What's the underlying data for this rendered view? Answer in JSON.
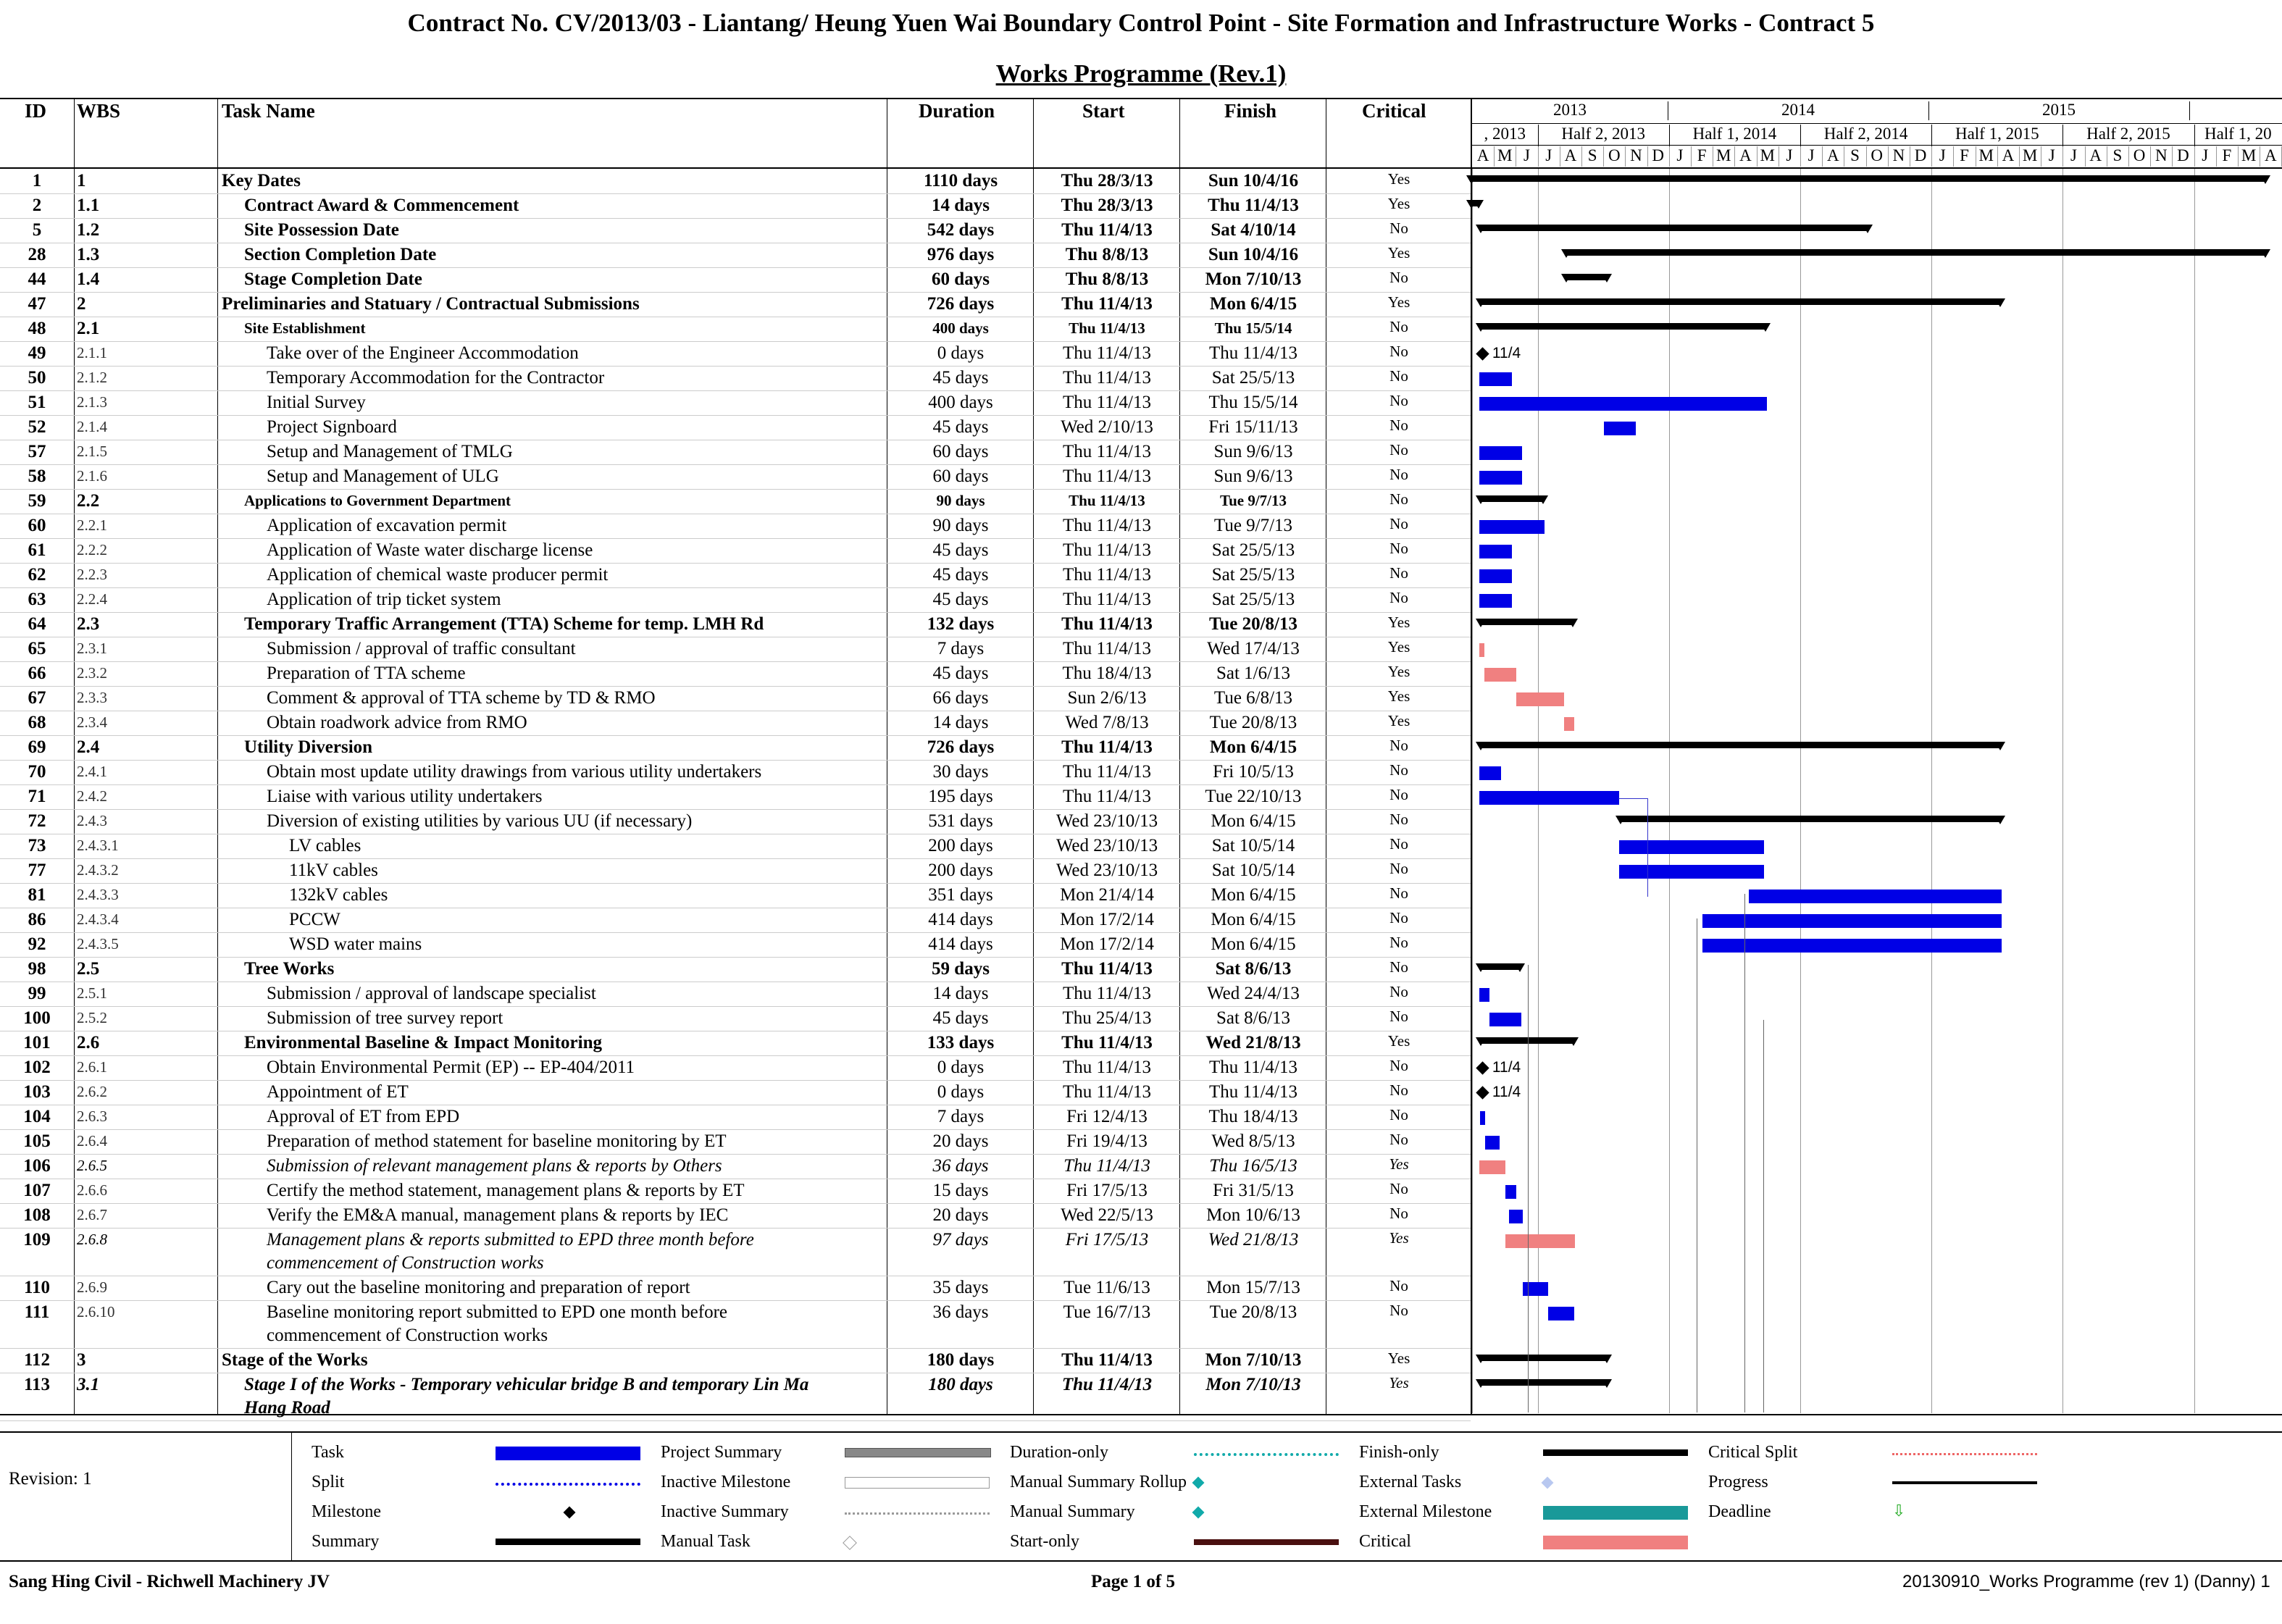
{
  "header": {
    "title": "Contract No. CV/2013/03 - Liantang/ Heung Yuen Wai Boundary Control Point - Site Formation and Infrastructure Works - Contract 5",
    "subtitle": "Works Programme (Rev.1)"
  },
  "columns": {
    "id": "ID",
    "wbs": "WBS",
    "task": "Task Name",
    "duration": "Duration",
    "start": "Start",
    "finish": "Finish",
    "critical": "Critical"
  },
  "timescale": {
    "years": [
      "2013",
      "2014",
      "2015"
    ],
    "halves": [
      ", 2013",
      "Half 2, 2013",
      "Half 1, 2014",
      "Half 2, 2014",
      "Half 1, 2015",
      "Half 2, 2015",
      "Half 1, 20"
    ],
    "months": [
      "A",
      "M",
      "J",
      "J",
      "A",
      "S",
      "O",
      "N",
      "D",
      "J",
      "F",
      "M",
      "A",
      "M",
      "J",
      "J",
      "A",
      "S",
      "O",
      "N",
      "D",
      "J",
      "F",
      "M",
      "A",
      "M",
      "J",
      "J",
      "A",
      "S",
      "O",
      "N",
      "D",
      "J",
      "F",
      "M",
      "A"
    ]
  },
  "tasks": [
    {
      "id": "1",
      "wbs": "1",
      "name": "Key Dates",
      "duration": "1110 days",
      "start": "Thu 28/3/13",
      "finish": "Sun 10/4/16",
      "critical": "Yes",
      "level": 0,
      "style": "b"
    },
    {
      "id": "2",
      "wbs": "1.1",
      "name": "Contract Award & Commencement",
      "duration": "14 days",
      "start": "Thu 28/3/13",
      "finish": "Thu 11/4/13",
      "critical": "Yes",
      "level": 1,
      "style": "b"
    },
    {
      "id": "5",
      "wbs": "1.2",
      "name": "Site Possession Date",
      "duration": "542 days",
      "start": "Thu 11/4/13",
      "finish": "Sat 4/10/14",
      "critical": "No",
      "level": 1,
      "style": "b"
    },
    {
      "id": "28",
      "wbs": "1.3",
      "name": "Section Completion Date",
      "duration": "976 days",
      "start": "Thu 8/8/13",
      "finish": "Sun 10/4/16",
      "critical": "Yes",
      "level": 1,
      "style": "b"
    },
    {
      "id": "44",
      "wbs": "1.4",
      "name": "Stage Completion Date",
      "duration": "60 days",
      "start": "Thu 8/8/13",
      "finish": "Mon 7/10/13",
      "critical": "No",
      "level": 1,
      "style": "b"
    },
    {
      "id": "47",
      "wbs": "2",
      "name": "Preliminaries and Statuary / Contractual Submissions",
      "duration": "726 days",
      "start": "Thu 11/4/13",
      "finish": "Mon 6/4/15",
      "critical": "Yes",
      "level": 0,
      "style": "b"
    },
    {
      "id": "48",
      "wbs": "2.1",
      "name": "Site Establishment",
      "duration": "400 days",
      "start": "Thu 11/4/13",
      "finish": "Thu 15/5/14",
      "critical": "No",
      "level": 1,
      "style": "bs"
    },
    {
      "id": "49",
      "wbs": "2.1.1",
      "name": "Take over of the Engineer Accommodation",
      "duration": "0 days",
      "start": "Thu 11/4/13",
      "finish": "Thu 11/4/13",
      "critical": "No",
      "level": 2,
      "style": ""
    },
    {
      "id": "50",
      "wbs": "2.1.2",
      "name": "Temporary Accommodation for the Contractor",
      "duration": "45 days",
      "start": "Thu 11/4/13",
      "finish": "Sat 25/5/13",
      "critical": "No",
      "level": 2,
      "style": ""
    },
    {
      "id": "51",
      "wbs": "2.1.3",
      "name": "Initial Survey",
      "duration": "400 days",
      "start": "Thu 11/4/13",
      "finish": "Thu 15/5/14",
      "critical": "No",
      "level": 2,
      "style": ""
    },
    {
      "id": "52",
      "wbs": "2.1.4",
      "name": "Project Signboard",
      "duration": "45 days",
      "start": "Wed 2/10/13",
      "finish": "Fri 15/11/13",
      "critical": "No",
      "level": 2,
      "style": ""
    },
    {
      "id": "57",
      "wbs": "2.1.5",
      "name": "Setup and Management of TMLG",
      "duration": "60 days",
      "start": "Thu 11/4/13",
      "finish": "Sun 9/6/13",
      "critical": "No",
      "level": 2,
      "style": ""
    },
    {
      "id": "58",
      "wbs": "2.1.6",
      "name": "Setup and Management of ULG",
      "duration": "60 days",
      "start": "Thu 11/4/13",
      "finish": "Sun 9/6/13",
      "critical": "No",
      "level": 2,
      "style": ""
    },
    {
      "id": "59",
      "wbs": "2.2",
      "name": "Applications to Government Department",
      "duration": "90 days",
      "start": "Thu 11/4/13",
      "finish": "Tue 9/7/13",
      "critical": "No",
      "level": 1,
      "style": "bs"
    },
    {
      "id": "60",
      "wbs": "2.2.1",
      "name": "Application of excavation permit",
      "duration": "90 days",
      "start": "Thu 11/4/13",
      "finish": "Tue 9/7/13",
      "critical": "No",
      "level": 2,
      "style": ""
    },
    {
      "id": "61",
      "wbs": "2.2.2",
      "name": "Application of Waste water discharge license",
      "duration": "45 days",
      "start": "Thu 11/4/13",
      "finish": "Sat 25/5/13",
      "critical": "No",
      "level": 2,
      "style": ""
    },
    {
      "id": "62",
      "wbs": "2.2.3",
      "name": "Application of chemical waste producer permit",
      "duration": "45 days",
      "start": "Thu 11/4/13",
      "finish": "Sat 25/5/13",
      "critical": "No",
      "level": 2,
      "style": ""
    },
    {
      "id": "63",
      "wbs": "2.2.4",
      "name": "Application of trip ticket system",
      "duration": "45 days",
      "start": "Thu 11/4/13",
      "finish": "Sat 25/5/13",
      "critical": "No",
      "level": 2,
      "style": ""
    },
    {
      "id": "64",
      "wbs": "2.3",
      "name": "Temporary Traffic Arrangement (TTA) Scheme for temp. LMH Rd",
      "duration": "132 days",
      "start": "Thu 11/4/13",
      "finish": "Tue 20/8/13",
      "critical": "Yes",
      "level": 1,
      "style": "b"
    },
    {
      "id": "65",
      "wbs": "2.3.1",
      "name": "Submission / approval of traffic consultant",
      "duration": "7 days",
      "start": "Thu 11/4/13",
      "finish": "Wed 17/4/13",
      "critical": "Yes",
      "level": 2,
      "style": ""
    },
    {
      "id": "66",
      "wbs": "2.3.2",
      "name": "Preparation of TTA scheme",
      "duration": "45 days",
      "start": "Thu 18/4/13",
      "finish": "Sat 1/6/13",
      "critical": "Yes",
      "level": 2,
      "style": ""
    },
    {
      "id": "67",
      "wbs": "2.3.3",
      "name": "Comment & approval of TTA scheme by TD & RMO",
      "duration": "66 days",
      "start": "Sun 2/6/13",
      "finish": "Tue 6/8/13",
      "critical": "Yes",
      "level": 2,
      "style": ""
    },
    {
      "id": "68",
      "wbs": "2.3.4",
      "name": "Obtain roadwork advice from RMO",
      "duration": "14 days",
      "start": "Wed 7/8/13",
      "finish": "Tue 20/8/13",
      "critical": "Yes",
      "level": 2,
      "style": ""
    },
    {
      "id": "69",
      "wbs": "2.4",
      "name": "Utility Diversion",
      "duration": "726 days",
      "start": "Thu 11/4/13",
      "finish": "Mon 6/4/15",
      "critical": "No",
      "level": 1,
      "style": "b"
    },
    {
      "id": "70",
      "wbs": "2.4.1",
      "name": "Obtain most update utility drawings from various utility undertakers",
      "duration": "30 days",
      "start": "Thu 11/4/13",
      "finish": "Fri 10/5/13",
      "critical": "No",
      "level": 2,
      "style": ""
    },
    {
      "id": "71",
      "wbs": "2.4.2",
      "name": "Liaise with various utility undertakers",
      "duration": "195 days",
      "start": "Thu 11/4/13",
      "finish": "Tue 22/10/13",
      "critical": "No",
      "level": 2,
      "style": ""
    },
    {
      "id": "72",
      "wbs": "2.4.3",
      "name": "Diversion of existing utilities by various UU (if necessary)",
      "duration": "531 days",
      "start": "Wed 23/10/13",
      "finish": "Mon 6/4/15",
      "critical": "No",
      "level": 2,
      "style": ""
    },
    {
      "id": "73",
      "wbs": "2.4.3.1",
      "name": "LV cables",
      "duration": "200 days",
      "start": "Wed 23/10/13",
      "finish": "Sat 10/5/14",
      "critical": "No",
      "level": 3,
      "style": ""
    },
    {
      "id": "77",
      "wbs": "2.4.3.2",
      "name": "11kV cables",
      "duration": "200 days",
      "start": "Wed 23/10/13",
      "finish": "Sat 10/5/14",
      "critical": "No",
      "level": 3,
      "style": ""
    },
    {
      "id": "81",
      "wbs": "2.4.3.3",
      "name": "132kV cables",
      "duration": "351 days",
      "start": "Mon 21/4/14",
      "finish": "Mon 6/4/15",
      "critical": "No",
      "level": 3,
      "style": ""
    },
    {
      "id": "86",
      "wbs": "2.4.3.4",
      "name": "PCCW",
      "duration": "414 days",
      "start": "Mon 17/2/14",
      "finish": "Mon 6/4/15",
      "critical": "No",
      "level": 3,
      "style": ""
    },
    {
      "id": "92",
      "wbs": "2.4.3.5",
      "name": "WSD water mains",
      "duration": "414 days",
      "start": "Mon 17/2/14",
      "finish": "Mon 6/4/15",
      "critical": "No",
      "level": 3,
      "style": ""
    },
    {
      "id": "98",
      "wbs": "2.5",
      "name": "Tree Works",
      "duration": "59 days",
      "start": "Thu 11/4/13",
      "finish": "Sat 8/6/13",
      "critical": "No",
      "level": 1,
      "style": "b"
    },
    {
      "id": "99",
      "wbs": "2.5.1",
      "name": "Submission / approval of landscape specialist",
      "duration": "14 days",
      "start": "Thu 11/4/13",
      "finish": "Wed 24/4/13",
      "critical": "No",
      "level": 2,
      "style": ""
    },
    {
      "id": "100",
      "wbs": "2.5.2",
      "name": "Submission of tree survey report",
      "duration": "45 days",
      "start": "Thu 25/4/13",
      "finish": "Sat 8/6/13",
      "critical": "No",
      "level": 2,
      "style": ""
    },
    {
      "id": "101",
      "wbs": "2.6",
      "name": "Environmental Baseline & Impact Monitoring",
      "duration": "133 days",
      "start": "Thu 11/4/13",
      "finish": "Wed 21/8/13",
      "critical": "Yes",
      "level": 1,
      "style": "b"
    },
    {
      "id": "102",
      "wbs": "2.6.1",
      "name": "Obtain Environmental Permit (EP) -- EP-404/2011",
      "duration": "0 days",
      "start": "Thu 11/4/13",
      "finish": "Thu 11/4/13",
      "critical": "No",
      "level": 2,
      "style": ""
    },
    {
      "id": "103",
      "wbs": "2.6.2",
      "name": "Appointment of ET",
      "duration": "0 days",
      "start": "Thu 11/4/13",
      "finish": "Thu 11/4/13",
      "critical": "No",
      "level": 2,
      "style": ""
    },
    {
      "id": "104",
      "wbs": "2.6.3",
      "name": "Approval of ET from EPD",
      "duration": "7 days",
      "start": "Fri 12/4/13",
      "finish": "Thu 18/4/13",
      "critical": "No",
      "level": 2,
      "style": ""
    },
    {
      "id": "105",
      "wbs": "2.6.4",
      "name": "Preparation of method statement for baseline monitoring by ET",
      "duration": "20 days",
      "start": "Fri 19/4/13",
      "finish": "Wed 8/5/13",
      "critical": "No",
      "level": 2,
      "style": ""
    },
    {
      "id": "106",
      "wbs": "2.6.5",
      "name": "Submission of relevant management plans & reports by Others",
      "duration": "36 days",
      "start": "Thu 11/4/13",
      "finish": "Thu 16/5/13",
      "critical": "Yes",
      "level": 2,
      "style": "i"
    },
    {
      "id": "107",
      "wbs": "2.6.6",
      "name": "Certify the method statement, management plans & reports by ET",
      "duration": "15 days",
      "start": "Fri 17/5/13",
      "finish": "Fri 31/5/13",
      "critical": "No",
      "level": 2,
      "style": ""
    },
    {
      "id": "108",
      "wbs": "2.6.7",
      "name": "Verify the EM&A manual, management plans & reports by IEC",
      "duration": "20 days",
      "start": "Wed 22/5/13",
      "finish": "Mon 10/6/13",
      "critical": "No",
      "level": 2,
      "style": ""
    },
    {
      "id": "109",
      "wbs": "2.6.8",
      "name": "Management plans & reports submitted to EPD three month before",
      "name2": "commencement of Construction works",
      "duration": "97 days",
      "start": "Fri 17/5/13",
      "finish": "Wed 21/8/13",
      "critical": "Yes",
      "level": 2,
      "style": "i"
    },
    {
      "id": "110",
      "wbs": "2.6.9",
      "name": "Cary out the baseline monitoring and preparation of report",
      "duration": "35 days",
      "start": "Tue 11/6/13",
      "finish": "Mon 15/7/13",
      "critical": "No",
      "level": 2,
      "style": ""
    },
    {
      "id": "111",
      "wbs": "2.6.10",
      "name": "Baseline monitoring report submitted to EPD one month before",
      "name2": "commencement of Construction works",
      "duration": "36 days",
      "start": "Tue 16/7/13",
      "finish": "Tue 20/8/13",
      "critical": "No",
      "level": 2,
      "style": ""
    },
    {
      "id": "112",
      "wbs": "3",
      "name": "Stage of the Works",
      "duration": "180 days",
      "start": "Thu 11/4/13",
      "finish": "Mon 7/10/13",
      "critical": "Yes",
      "level": 0,
      "style": "b"
    },
    {
      "id": "113",
      "wbs": "3.1",
      "name": "Stage I of the Works - Temporary vehicular bridge B and temporary Lin Ma",
      "name2": "Hang Road",
      "duration": "180 days",
      "start": "Thu 11/4/13",
      "finish": "Mon 7/10/13",
      "critical": "Yes",
      "level": 1,
      "style": "bi"
    }
  ],
  "milestone_labels": {
    "m49": "11/4",
    "m102": "11/4",
    "m103": "11/4"
  },
  "legend": {
    "revision": "Revision: 1",
    "col1": [
      "Task",
      "Split",
      "Milestone",
      "Summary"
    ],
    "col2": [
      "Project Summary",
      "Inactive Milestone",
      "Inactive Summary",
      "Manual Task"
    ],
    "col3": [
      "Duration-only",
      "Manual Summary Rollup",
      "Manual Summary",
      "Start-only"
    ],
    "col4": [
      "Finish-only",
      "External Tasks",
      "External Milestone",
      "Critical"
    ],
    "col5": [
      "Critical Split",
      "Progress",
      "Deadline"
    ]
  },
  "footer": {
    "left": "Sang Hing Civil - Richwell Machinery JV",
    "center": "Page 1 of 5",
    "right": "20130910_Works Programme (rev 1) (Danny) 1"
  },
  "colors": {
    "task": "#0000e6",
    "critical": "#f08080",
    "summary": "#000000",
    "link_blue": "#3333cc",
    "link_red": "#cc0000"
  }
}
